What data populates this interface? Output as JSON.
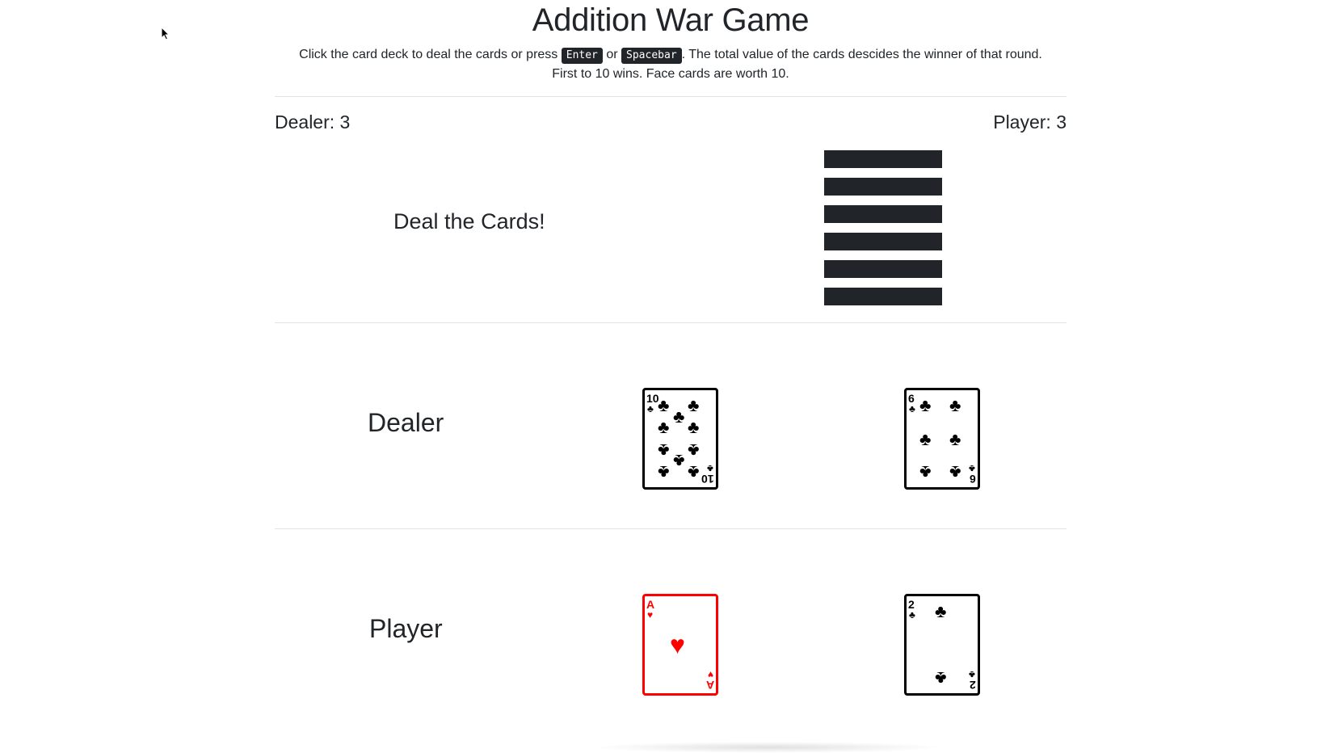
{
  "title": "Addition War Game",
  "instructions": {
    "line1_before": "Click the card deck to deal the cards or press",
    "key1": "Enter",
    "or": "or",
    "key2": "Spacebar",
    "line1_after": ". The total value of the cards descides the winner of that round.",
    "line2": "First to 10 wins. Face cards are worth 10."
  },
  "scores": {
    "dealer": "Dealer: 3",
    "player": "Player: 3"
  },
  "deal_prompt": "Deal the Cards!",
  "rows": {
    "dealer_label": "Dealer",
    "player_label": "Player"
  },
  "cards": {
    "dealer": [
      {
        "rank": "10",
        "suit": "♣",
        "color": "#000000"
      },
      {
        "rank": "6",
        "suit": "♣",
        "color": "#000000"
      }
    ],
    "player": [
      {
        "rank": "A",
        "suit": "♥",
        "color": "#ff0000"
      },
      {
        "rank": "2",
        "suit": "♣",
        "color": "#000000"
      }
    ]
  },
  "colors": {
    "text": "#212529",
    "deck": "#212529",
    "red_suit": "#ff0000",
    "black_suit": "#000000"
  }
}
